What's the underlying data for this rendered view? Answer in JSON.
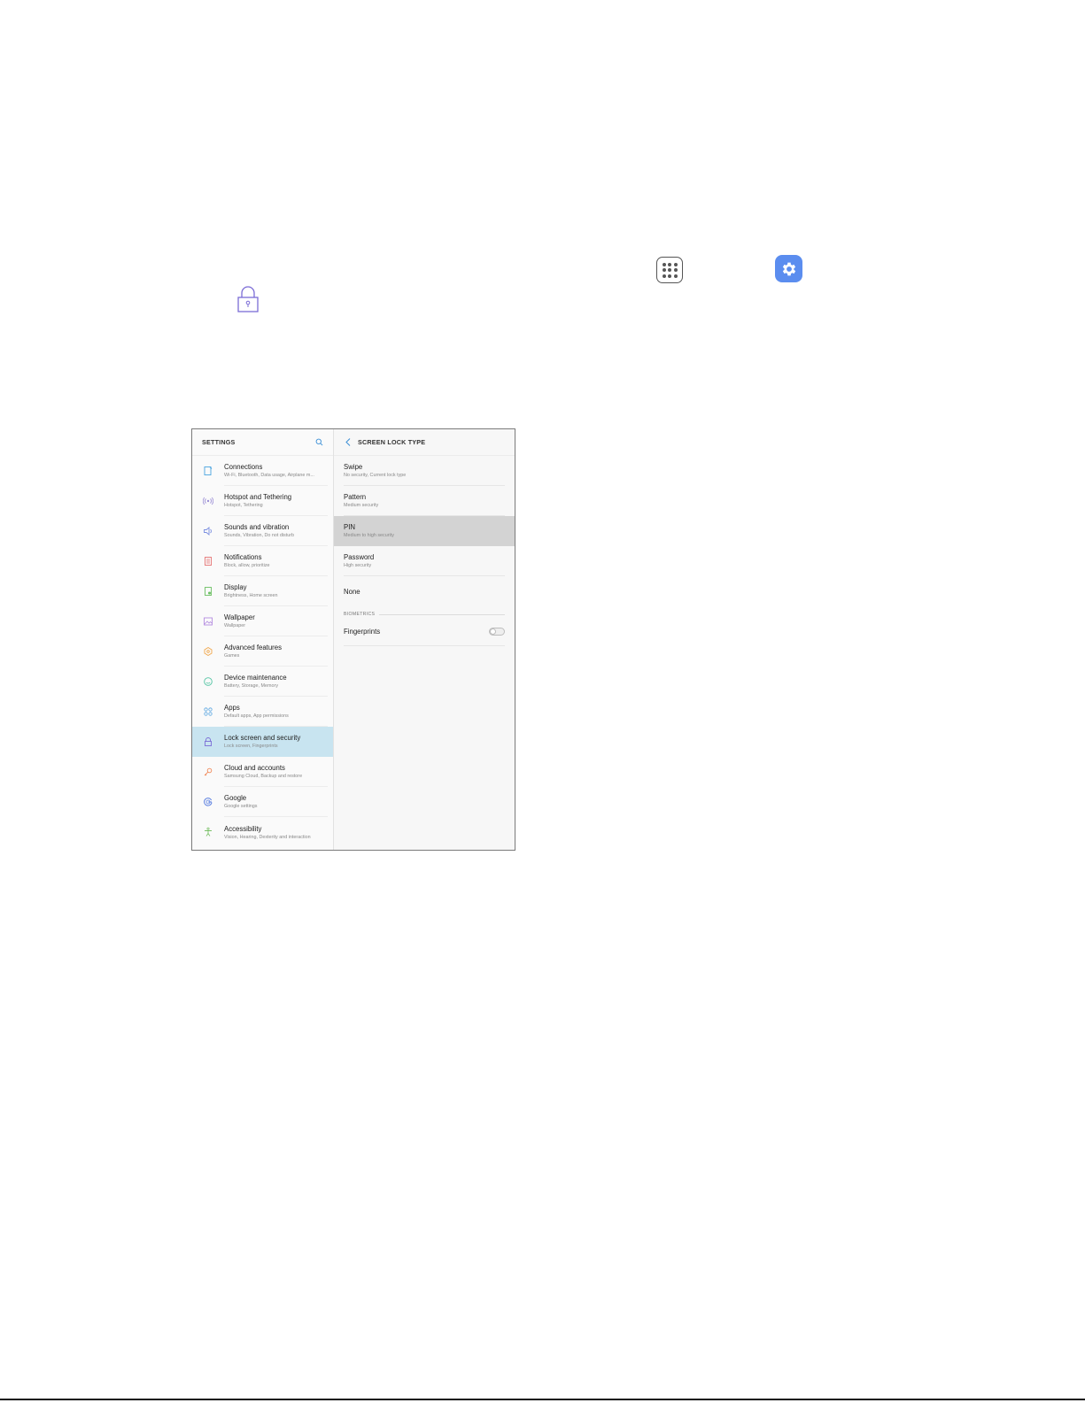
{
  "icons": {
    "apps": "apps-grid-icon",
    "settings": "settings-gear-icon",
    "lock": "lock-icon"
  },
  "colors": {
    "settings_icon_bg": "#5b8def",
    "selected_row_bg": "#c8e4f0",
    "highlight_row_bg": "#d3d3d3",
    "lock_icon": "#7b6cd6",
    "search_icon": "#3a8fd6",
    "back_icon": "#3a8fd6"
  },
  "settings": {
    "title": "SETTINGS",
    "items": [
      {
        "label": "Connections",
        "sub": "Wi-Fi, Bluetooth, Data usage, Airplane m...",
        "icon": "connections-icon",
        "color": "#4aa3df"
      },
      {
        "label": "Hotspot and Tethering",
        "sub": "Hotspot, Tethering",
        "icon": "hotspot-icon",
        "color": "#9c8fd6"
      },
      {
        "label": "Sounds and vibration",
        "sub": "Sounds, Vibration, Do not disturb",
        "icon": "sound-icon",
        "color": "#7b8fe0"
      },
      {
        "label": "Notifications",
        "sub": "Block, allow, prioritize",
        "icon": "notifications-icon",
        "color": "#e57373"
      },
      {
        "label": "Display",
        "sub": "Brightness, Home screen",
        "icon": "display-icon",
        "color": "#6cbf63"
      },
      {
        "label": "Wallpaper",
        "sub": "Wallpaper",
        "icon": "wallpaper-icon",
        "color": "#b48be0"
      },
      {
        "label": "Advanced features",
        "sub": "Games",
        "icon": "advanced-features-icon",
        "color": "#f0a64a"
      },
      {
        "label": "Device maintenance",
        "sub": "Battery, Storage, Memory",
        "icon": "device-maintenance-icon",
        "color": "#4fc3a1"
      },
      {
        "label": "Apps",
        "sub": "Default apps, App permissions",
        "icon": "apps-icon",
        "color": "#5aa6e0"
      },
      {
        "label": "Lock screen and security",
        "sub": "Lock screen, Fingerprints",
        "icon": "lock-icon",
        "color": "#7b6cd6"
      },
      {
        "label": "Cloud and accounts",
        "sub": "Samsung Cloud, Backup and restore",
        "icon": "cloud-key-icon",
        "color": "#f08a5a"
      },
      {
        "label": "Google",
        "sub": "Google settings",
        "icon": "google-icon",
        "color": "#5b7fe0"
      },
      {
        "label": "Accessibility",
        "sub": "Vision, Hearing, Dexterity and interaction",
        "icon": "accessibility-icon",
        "color": "#7cc26a"
      }
    ]
  },
  "screen_lock": {
    "title": "SCREEN LOCK TYPE",
    "options": [
      {
        "label": "Swipe",
        "sub": "No security, Current lock type"
      },
      {
        "label": "Pattern",
        "sub": "Medium security"
      },
      {
        "label": "PIN",
        "sub": "Medium to high security"
      },
      {
        "label": "Password",
        "sub": "High security"
      },
      {
        "label": "None",
        "sub": ""
      }
    ],
    "biometrics_header": "BIOMETRICS",
    "fingerprints_label": "Fingerprints"
  }
}
